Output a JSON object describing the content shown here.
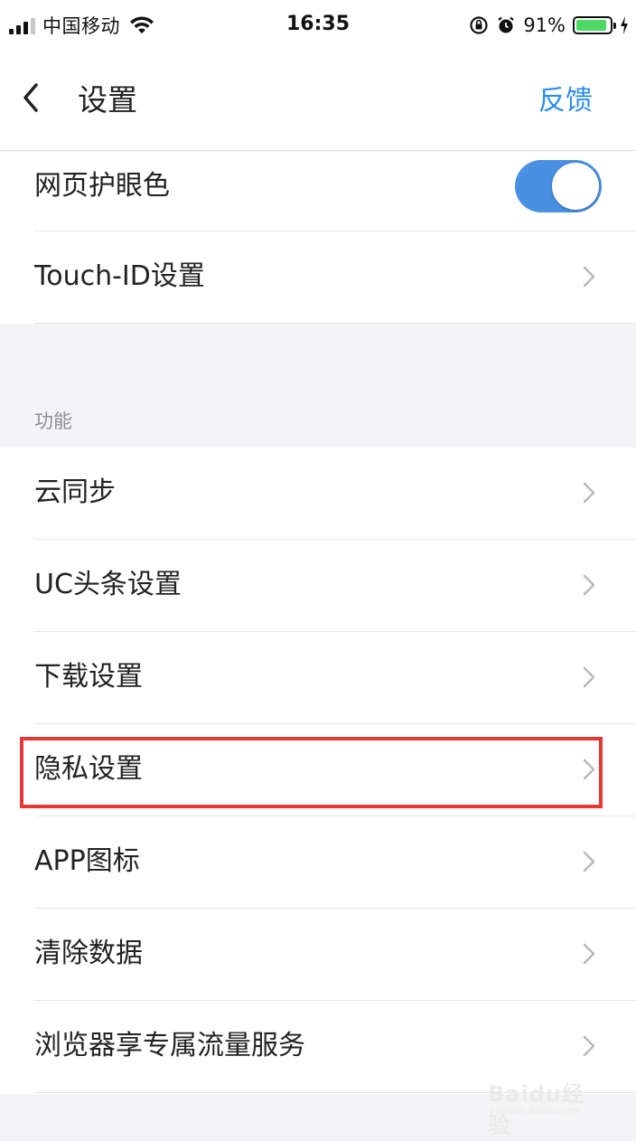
{
  "status_bar": {
    "carrier": "中国移动",
    "time": "16:35",
    "battery_percent": "91%",
    "battery_level": 0.91,
    "icons": [
      "signal-icon",
      "wifi-icon",
      "orientation-lock-icon",
      "alarm-icon",
      "battery-icon",
      "charging-icon"
    ]
  },
  "nav": {
    "back_icon": "chevron-left-icon",
    "title": "设置",
    "feedback": "反馈"
  },
  "top_rows": [
    {
      "label": "网页护眼色",
      "type": "toggle",
      "on": true
    },
    {
      "label": "Touch-ID设置",
      "type": "link"
    }
  ],
  "section": {
    "title": "功能",
    "items": [
      {
        "label": "云同步"
      },
      {
        "label": "UC头条设置"
      },
      {
        "label": "下载设置"
      },
      {
        "label": "隐私设置",
        "highlighted": true
      },
      {
        "label": "APP图标"
      },
      {
        "label": "清除数据"
      },
      {
        "label": "浏览器享专属流量服务"
      }
    ]
  },
  "colors": {
    "accent": "#2b8cf0",
    "toggle_on": "#4a90e2",
    "highlight": "#e53935",
    "section_bg": "#f4f4f6"
  },
  "watermark": {
    "main": "Baidu经验",
    "sub": "jingyan.baidu.com"
  }
}
